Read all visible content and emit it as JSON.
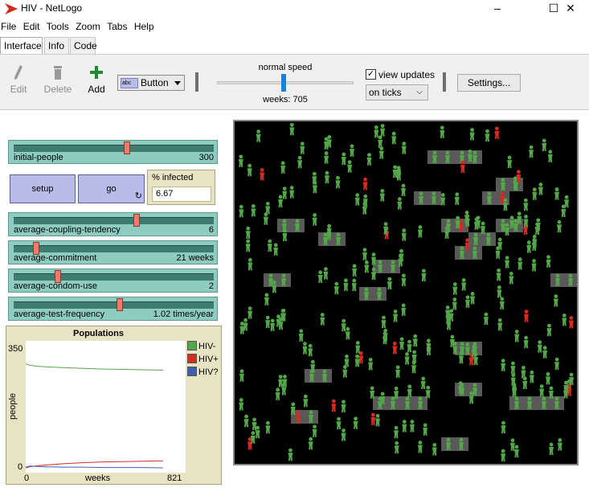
{
  "window": {
    "title": "HIV - NetLogo",
    "minimize": "–",
    "maximize": "☐",
    "close": "✕"
  },
  "menu": [
    "File",
    "Edit",
    "Tools",
    "Zoom",
    "Tabs",
    "Help"
  ],
  "tabs": [
    "Interface",
    "Info",
    "Code"
  ],
  "toolbar": {
    "edit_label": "Edit",
    "delete_label": "Delete",
    "add_label": "Add",
    "widget_type": "Button",
    "speed_label": "normal speed",
    "speed_fraction": 0.5,
    "weeks_label": "weeks: 705",
    "view_updates_label": "view updates",
    "view_updates_checked": true,
    "update_mode": "on ticks",
    "settings_label": "Settings..."
  },
  "sliders": [
    {
      "name": "initial-people",
      "value": "300",
      "fraction": 0.57
    },
    {
      "name": "average-coupling-tendency",
      "value": "6",
      "fraction": 0.62
    },
    {
      "name": "average-commitment",
      "value": "21 weeks",
      "fraction": 0.1
    },
    {
      "name": "average-condom-use",
      "value": "2",
      "fraction": 0.21
    },
    {
      "name": "average-test-frequency",
      "value": "1.02 times/year",
      "fraction": 0.53
    }
  ],
  "buttons": {
    "setup": "setup",
    "go": "go",
    "forever_icon": "↻"
  },
  "monitor": {
    "label": "% infected",
    "value": "6.67"
  },
  "plot": {
    "title": "Populations",
    "ylabel": "people",
    "xlabel": "weeks",
    "xmin": "0",
    "xmax": "821",
    "ymin": "0",
    "ymax": "350",
    "legend": [
      {
        "name": "HIV-",
        "color": "#54a64a"
      },
      {
        "name": "HIV+",
        "color": "#d72a20"
      },
      {
        "name": "HIV?",
        "color": "#3f5fb5"
      }
    ]
  },
  "chart_data": {
    "type": "line",
    "title": "Populations",
    "xlabel": "weeks",
    "ylabel": "people",
    "xlim": [
      0,
      821
    ],
    "ylim": [
      0,
      350
    ],
    "series": [
      {
        "name": "HIV-",
        "color": "#54a64a",
        "x": [
          0,
          20,
          60,
          120,
          200,
          300,
          400,
          500,
          600,
          705
        ],
        "values": [
          298,
          294,
          291,
          289,
          287,
          285,
          283,
          282,
          281,
          280
        ]
      },
      {
        "name": "HIV+",
        "color": "#d72a20",
        "x": [
          0,
          20,
          60,
          120,
          200,
          300,
          400,
          500,
          600,
          705
        ],
        "values": [
          0,
          3,
          6,
          9,
          12,
          15,
          17,
          18,
          19,
          20
        ]
      },
      {
        "name": "HIV?",
        "color": "#3f5fb5",
        "x": [
          0,
          20,
          60,
          120,
          200,
          300,
          400,
          500,
          600,
          705
        ],
        "values": [
          2,
          5,
          4,
          3,
          2,
          2,
          1,
          1,
          1,
          0
        ]
      }
    ]
  },
  "world": {
    "background": "#000000",
    "uninfected_color": "#54a64a",
    "infected_color": "#d72a20",
    "couple_patch_color": "#595959",
    "people_counts": {
      "uninfected": 280,
      "infected": 20
    }
  }
}
